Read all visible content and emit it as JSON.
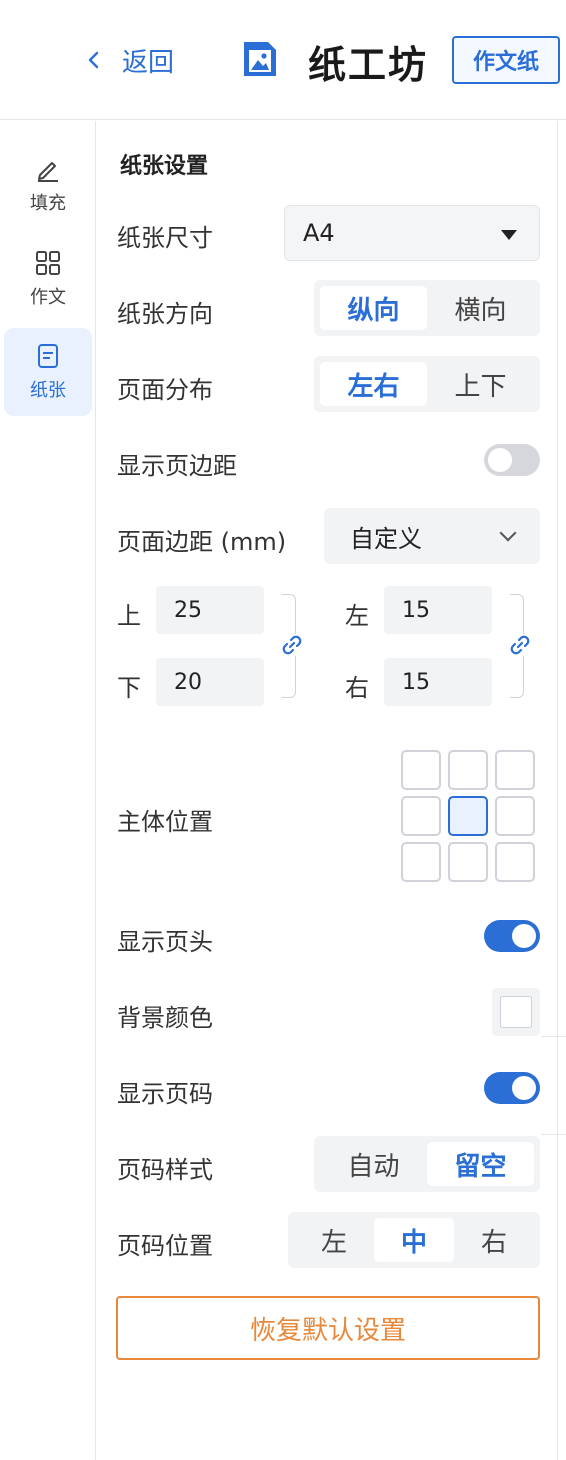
{
  "header": {
    "back_label": "返回",
    "app_title": "纸工坊",
    "badge": "作文纸",
    "accent": "#2b6fd6"
  },
  "sidenav": {
    "items": [
      {
        "label": "填充",
        "icon": "pencil-icon",
        "active": false
      },
      {
        "label": "作文",
        "icon": "grid-icon",
        "active": false
      },
      {
        "label": "纸张",
        "icon": "document-icon",
        "active": true
      }
    ]
  },
  "panel": {
    "title": "纸张设置",
    "paper_size": {
      "label": "纸张尺寸",
      "value": "A4"
    },
    "orientation": {
      "label": "纸张方向",
      "options": [
        "纵向",
        "横向"
      ],
      "selected": "纵向"
    },
    "distribution": {
      "label": "页面分布",
      "options": [
        "左右",
        "上下"
      ],
      "selected": "左右"
    },
    "show_margin": {
      "label": "显示页边距",
      "on": false
    },
    "margin": {
      "label": "页面边距 (mm)",
      "mode": "自定义",
      "top": {
        "label": "上",
        "value": "25"
      },
      "bottom": {
        "label": "下",
        "value": "20"
      },
      "left": {
        "label": "左",
        "value": "15"
      },
      "right": {
        "label": "右",
        "value": "15"
      }
    },
    "body_position": {
      "label": "主体位置",
      "selected_row": 1,
      "selected_col": 1
    },
    "show_header": {
      "label": "显示页头",
      "on": true
    },
    "background_color": {
      "label": "背景颜色",
      "value": "#ffffff"
    },
    "show_page_number": {
      "label": "显示页码",
      "on": true
    },
    "page_number_style": {
      "label": "页码样式",
      "options": [
        "自动",
        "留空"
      ],
      "selected": "留空"
    },
    "page_number_position": {
      "label": "页码位置",
      "options": [
        "左",
        "中",
        "右"
      ],
      "selected": "中"
    },
    "reset_label": "恢复默认设置",
    "reset_color": "#e8883a"
  }
}
